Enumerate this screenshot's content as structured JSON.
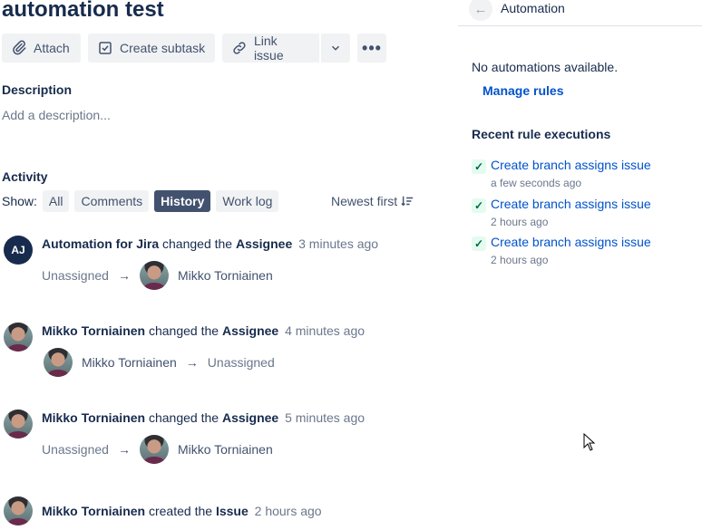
{
  "issue": {
    "title": "automation test"
  },
  "toolbar": {
    "attach": "Attach",
    "create_subtask": "Create subtask",
    "link_issue": "Link issue"
  },
  "description": {
    "heading": "Description",
    "placeholder": "Add a description..."
  },
  "activity": {
    "heading": "Activity",
    "show_label": "Show:",
    "filters": [
      "All",
      "Comments",
      "History",
      "Work log"
    ],
    "active_filter": "History",
    "sort": "Newest first"
  },
  "entries": [
    {
      "avatar_initials": "AJ",
      "actor": "Automation for Jira",
      "verb": "changed the",
      "field": "Assignee",
      "time": "3 minutes ago",
      "from": "Unassigned",
      "to": "Mikko Torniainen"
    },
    {
      "actor": "Mikko Torniainen",
      "verb": "changed the",
      "field": "Assignee",
      "time": "4 minutes ago",
      "from": "Mikko Torniainen",
      "to": "Unassigned"
    },
    {
      "actor": "Mikko Torniainen",
      "verb": "changed the",
      "field": "Assignee",
      "time": "5 minutes ago",
      "from": "Unassigned",
      "to": "Mikko Torniainen"
    },
    {
      "actor": "Mikko Torniainen",
      "verb": "created the",
      "field": "Issue",
      "time": "2 hours ago"
    }
  ],
  "automation": {
    "title": "Automation",
    "empty_text": "No automations available.",
    "manage_rules": "Manage rules",
    "recent_heading": "Recent rule executions",
    "executions": [
      {
        "name": "Create branch assigns issue",
        "time": "a few seconds ago"
      },
      {
        "name": "Create branch assigns issue",
        "time": "2 hours ago"
      },
      {
        "name": "Create branch assigns issue",
        "time": "2 hours ago"
      }
    ]
  },
  "colors": {
    "link": "#0052cc",
    "active_filter_bg": "#42526e",
    "text": "#172b4d"
  }
}
